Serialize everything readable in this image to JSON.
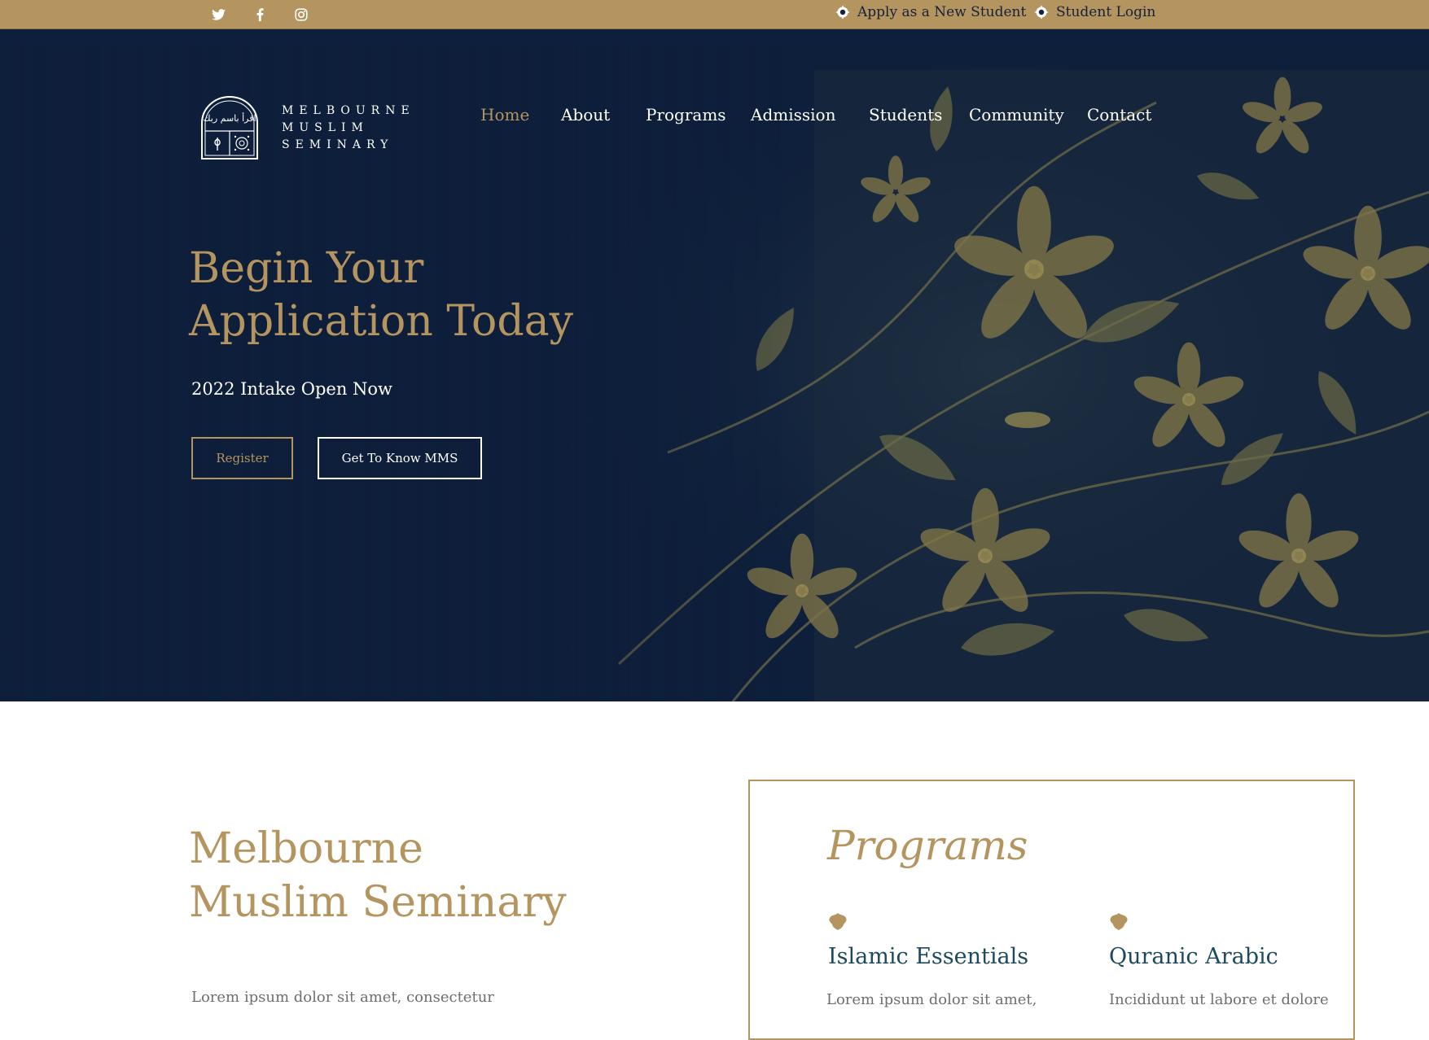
{
  "top_bar": {
    "social": [
      {
        "icon": "twitter-icon"
      },
      {
        "icon": "facebook-icon"
      },
      {
        "icon": "instagram-icon"
      }
    ],
    "links": [
      {
        "label": "Apply as a New Student",
        "icon": "flower-badge-icon"
      },
      {
        "label": "Student Login",
        "icon": "flower-badge-icon"
      }
    ]
  },
  "header": {
    "logo": {
      "line1": "MELBOURNE",
      "line2": "MUSLIM",
      "line3": "SEMINARY",
      "arabic": "اقرأ باسم ربك"
    },
    "nav": [
      {
        "label": "Home",
        "active": true
      },
      {
        "label": "About",
        "active": false
      },
      {
        "label": "Programs",
        "active": false
      },
      {
        "label": "Admission",
        "active": false
      },
      {
        "label": "Students",
        "active": false
      },
      {
        "label": "Community",
        "active": false
      },
      {
        "label": "Contact",
        "active": false
      }
    ]
  },
  "hero": {
    "title_line1": "Begin Your",
    "title_line2": "Application Today",
    "subtitle": "2022 Intake Open Now",
    "register_label": "Register",
    "know_label": "Get To Know MMS"
  },
  "about": {
    "title_line1": "Melbourne",
    "title_line2": "Muslim Seminary",
    "text": "Lorem ipsum dolor sit amet, consectetur"
  },
  "programs": {
    "title": "Programs",
    "items": [
      {
        "name": "Islamic Essentials",
        "desc": "Lorem ipsum dolor sit amet,",
        "icon": "ornament-icon"
      },
      {
        "name": "Quranic Arabic",
        "desc": "Incididunt ut labore et dolore",
        "icon": "ornament-icon"
      }
    ]
  },
  "colors": {
    "gold": "#b4945f",
    "navy": "#0e1f3b",
    "teal_heading": "#1c4a5c",
    "body_text": "#6e6e6e"
  }
}
